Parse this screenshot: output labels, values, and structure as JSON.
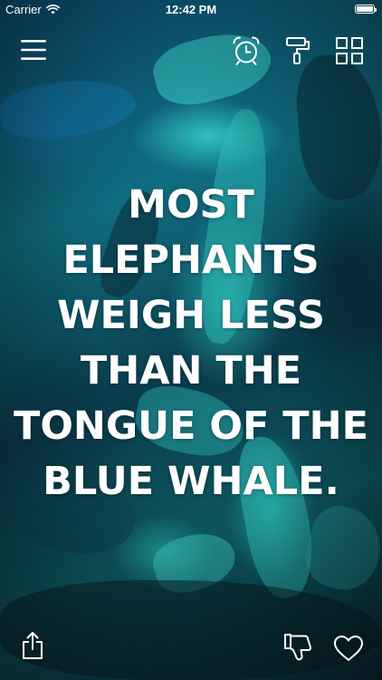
{
  "status_bar": {
    "carrier": "Carrier",
    "time": "12:42 PM",
    "battery_level": 1.0
  },
  "toolbar": {
    "menu_icon": "hamburger-menu-icon",
    "alarm_icon": "alarm-clock-icon",
    "theme_icon": "paint-roller-icon",
    "categories_icon": "grid-icon"
  },
  "fact": {
    "lines": [
      "MOST",
      "ELEPHANTS",
      "WEIGH LESS",
      "THAN THE",
      "TONGUE OF THE",
      "BLUE WHALE."
    ]
  },
  "bottom_bar": {
    "share_icon": "share-icon",
    "dislike_icon": "thumbs-down-icon",
    "like_icon": "heart-icon"
  },
  "colors": {
    "background_teal": "#2fc6c0",
    "background_blue": "#0c4f73",
    "background_dark": "#082a34",
    "foreground": "#ffffff"
  }
}
